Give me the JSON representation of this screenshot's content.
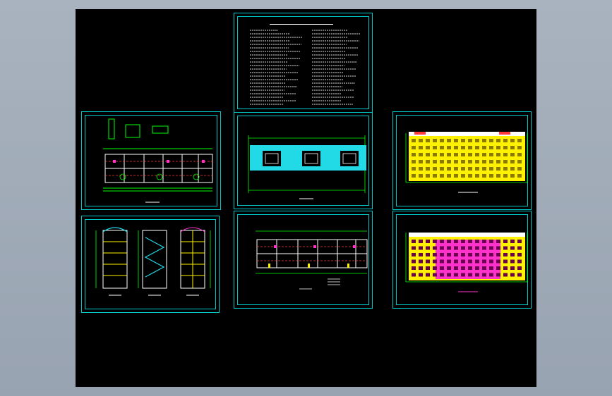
{
  "viewport": {
    "background": "#000000",
    "frame_color": "#00c9c9",
    "line_colors": {
      "wall": "#ffffff",
      "dimension": "#00ff00",
      "grid": "#ff3b3b",
      "fill_cyan": "#22d9e6",
      "fill_yellow": "#fff200",
      "fill_magenta": "#ff33cc"
    }
  },
  "sheets": [
    {
      "id": "design-notes",
      "kind": "text"
    },
    {
      "id": "ground-floor-plan",
      "kind": "plan"
    },
    {
      "id": "roof-plan",
      "kind": "roof"
    },
    {
      "id": "front-elevation",
      "kind": "elevation-yellow"
    },
    {
      "id": "sections",
      "kind": "section"
    },
    {
      "id": "standard-floor-plan",
      "kind": "plan2"
    },
    {
      "id": "rear-elevation",
      "kind": "elevation-magenta"
    }
  ]
}
